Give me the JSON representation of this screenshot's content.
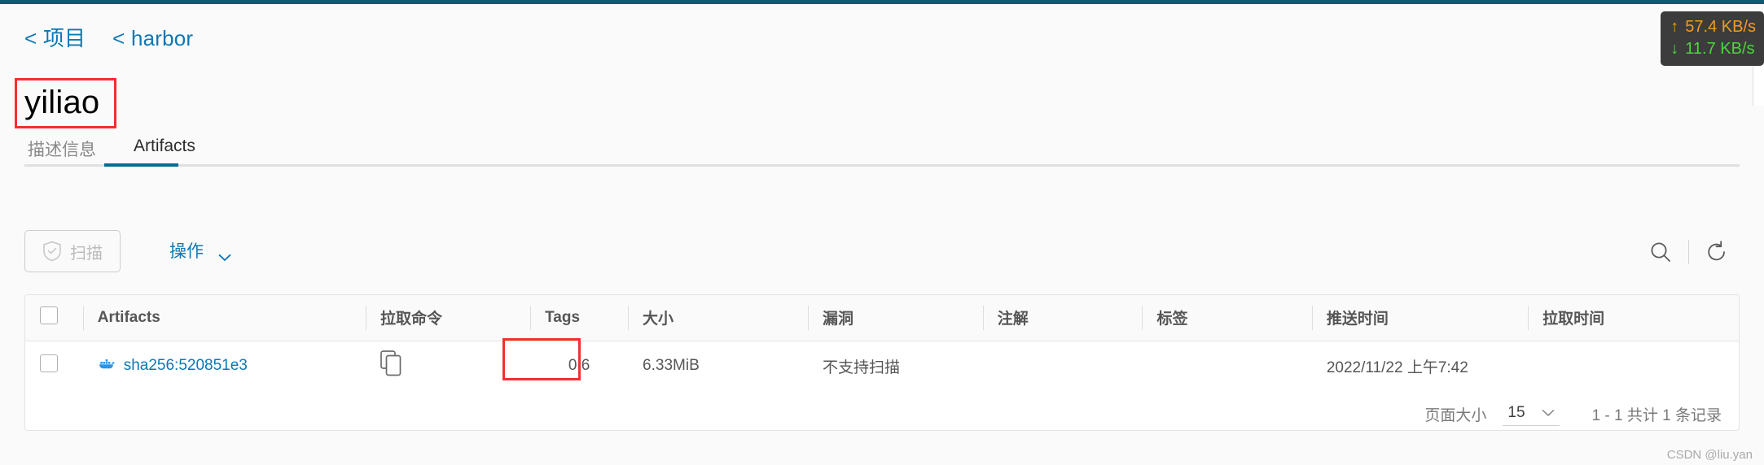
{
  "breadcrumb": {
    "items": [
      {
        "prefix": "<",
        "label": "项目"
      },
      {
        "prefix": "<",
        "label": "harbor"
      }
    ]
  },
  "page_title": "yiliao",
  "tabs": [
    {
      "label": "描述信息",
      "active": false
    },
    {
      "label": "Artifacts",
      "active": true
    }
  ],
  "toolbar": {
    "scan_label": "扫描",
    "scan_icon": "shield-check-icon",
    "action_label": "操作",
    "action_chevron_icon": "chevron-down-icon",
    "search_icon": "search-icon",
    "refresh_icon": "refresh-icon"
  },
  "table": {
    "columns": [
      "Artifacts",
      "拉取命令",
      "Tags",
      "大小",
      "漏洞",
      "注解",
      "标签",
      "推送时间",
      "拉取时间"
    ],
    "rows": [
      {
        "artifact": "sha256:520851e3",
        "artifact_icon": "docker-whale-icon",
        "pull_command_icon": "copy-icon",
        "tags": "0.6",
        "size": "6.33MiB",
        "vulnerabilities": "不支持扫描",
        "annotations": "",
        "labels": "",
        "push_time": "2022/11/22 上午7:42",
        "pull_time": ""
      }
    ]
  },
  "pagination": {
    "page_size_label": "页面大小",
    "page_size_value": "15",
    "page_size_chevron_icon": "chevron-down-icon",
    "total_label": "1 - 1 共计 1 条记录"
  },
  "netspeed": {
    "upload_arrow": "↑",
    "upload": "57.4 KB/s",
    "download_arrow": "↓",
    "download": "11.7 KB/s",
    "upload_color": "#f49b20",
    "download_color": "#49d83a"
  },
  "watermark": "CSDN @liu.yan",
  "colors": {
    "accent": "#0d78b4",
    "tab_active_underline": "#0b6a94",
    "annotation_red": "#f2302f",
    "topbar": "#0f5a72"
  }
}
